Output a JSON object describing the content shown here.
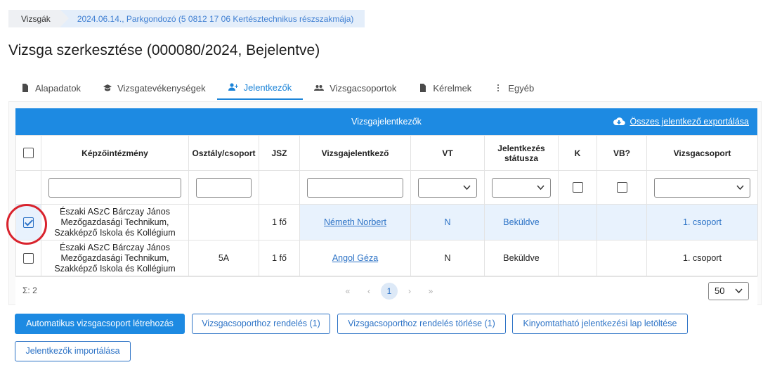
{
  "breadcrumb": {
    "root": "Vizsgák",
    "current": "2024.06.14., Parkgondozó (5 0812 17 06 Kertésztechnikus részszakmája)"
  },
  "page": {
    "title": "Vizsga szerkesztése (000080/2024, Bejelentve)"
  },
  "tabs": [
    {
      "label": "Alapadatok",
      "icon": "document-icon"
    },
    {
      "label": "Vizsgatevékenységek",
      "icon": "graduation-cap-icon"
    },
    {
      "label": "Jelentkezők",
      "icon": "add-user-icon"
    },
    {
      "label": "Vizsgacsoportok",
      "icon": "group-icon"
    },
    {
      "label": "Kérelmek",
      "icon": "document-icon"
    },
    {
      "label": "Egyéb",
      "icon": "more-vertical-icon"
    }
  ],
  "grid": {
    "title": "Vizsgajelentkezők",
    "export_label": "Összes jelentkező exportálása",
    "columns": {
      "institution": "Képzőintézmény",
      "class": "Osztály/csoport",
      "jsz": "JSZ",
      "applicant": "Vizsgajelentkező",
      "vt": "VT",
      "status": "Jelentkezés státusza",
      "k": "K",
      "vb": "VB?",
      "group": "Vizsgacsoport"
    },
    "rows": [
      {
        "checked": true,
        "institution": "Északi ASzC Bárczay János Mezőgazdasági Technikum, Szakképző Iskola és Kollégium",
        "class": "",
        "jsz": "1 fő",
        "applicant": "Németh Norbert",
        "vt": "N",
        "status": "Beküldve",
        "k": "",
        "vb": "",
        "group": "1. csoport"
      },
      {
        "checked": false,
        "institution": "Északi ASzC Bárczay János Mezőgazdasági Technikum, Szakképző Iskola és Kollégium",
        "class": "5A",
        "jsz": "1 fő",
        "applicant": "Angol Géza",
        "vt": "N",
        "status": "Beküldve",
        "k": "",
        "vb": "",
        "group": "1. csoport"
      }
    ],
    "footer": {
      "sum": "Σ: 2",
      "pager": {
        "first": "«",
        "prev": "‹",
        "current": "1",
        "next": "›",
        "last": "»"
      },
      "page_size": "50"
    }
  },
  "buttons": {
    "auto_group": "Automatikus vizsgacsoport létrehozás",
    "assign": "Vizsgacsoporthoz rendelés (1)",
    "unassign": "Vizsgacsoporthoz rendelés törlése (1)",
    "print": "Kinyomtatható jelentkezési lap letöltése",
    "import": "Jelentkezők importálása"
  },
  "colors": {
    "accent": "#1d8ae2",
    "link": "#2d73c6",
    "highlight": "#d9232d"
  }
}
